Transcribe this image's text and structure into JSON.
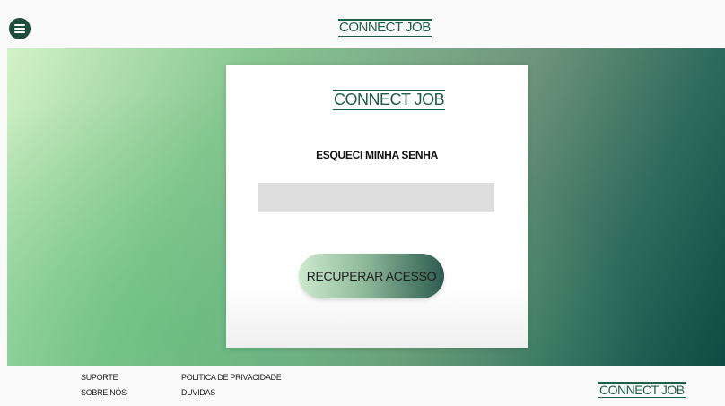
{
  "header": {
    "menu_icon": "hamburger-menu-icon",
    "logo": "CONNECT JOB"
  },
  "card": {
    "logo": "CONNECT JOB",
    "title": "ESQUECI MINHA SENHA",
    "email_input": {
      "value": "",
      "placeholder": ""
    },
    "button_label": "RECUPERAR ACESSO"
  },
  "footer": {
    "links": {
      "suporte": "SUPORTE",
      "sobre": "SOBRE NÓS",
      "politica": "POLITICA DE PRIVACIDADE",
      "duvidas": "DUVIDAS"
    },
    "logo": "CONNECT JOB"
  },
  "colors": {
    "brand_green": "#1f5f45",
    "menu_button": "#1f4d3c",
    "input_bg": "#dedede"
  }
}
